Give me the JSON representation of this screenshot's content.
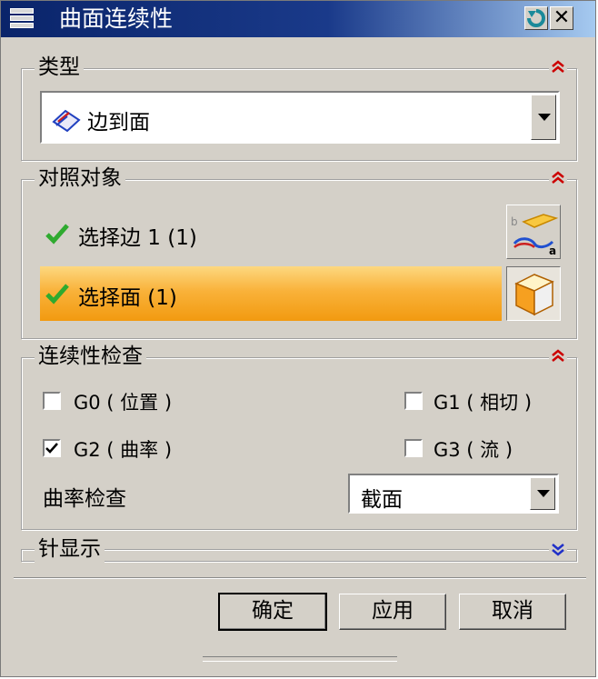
{
  "window": {
    "title": "曲面连续性"
  },
  "colors": {
    "titlebar": "#0a246a",
    "active_row": "#f9b23a",
    "check": "#2faa2f",
    "collapse_up": "#cc0000",
    "collapse_down": "#2030c8"
  },
  "type_group": {
    "title": "类型",
    "selected": "边到面",
    "icon": "edge-to-face-icon"
  },
  "compare_group": {
    "title": "对照对象",
    "rows": [
      {
        "label": "选择边 1 (1)",
        "icon": "check-icon",
        "side_icon": "edge-selection-icon"
      },
      {
        "label": "选择面 (1)",
        "icon": "check-icon",
        "side_icon": "face-selection-icon"
      }
    ]
  },
  "continuity_group": {
    "title": "连续性检查",
    "options": [
      {
        "label": "G0 ( 位置 )",
        "checked": false
      },
      {
        "label": "G1 ( 相切 )",
        "checked": false
      },
      {
        "label": "G2 ( 曲率 )",
        "checked": true
      },
      {
        "label": "G3 ( 流 )",
        "checked": false
      }
    ],
    "curvature_label": "曲率检查",
    "curvature_value": "截面"
  },
  "needle_group": {
    "title": "针显示"
  },
  "buttons": {
    "ok": "确定",
    "apply": "应用",
    "cancel": "取消"
  }
}
